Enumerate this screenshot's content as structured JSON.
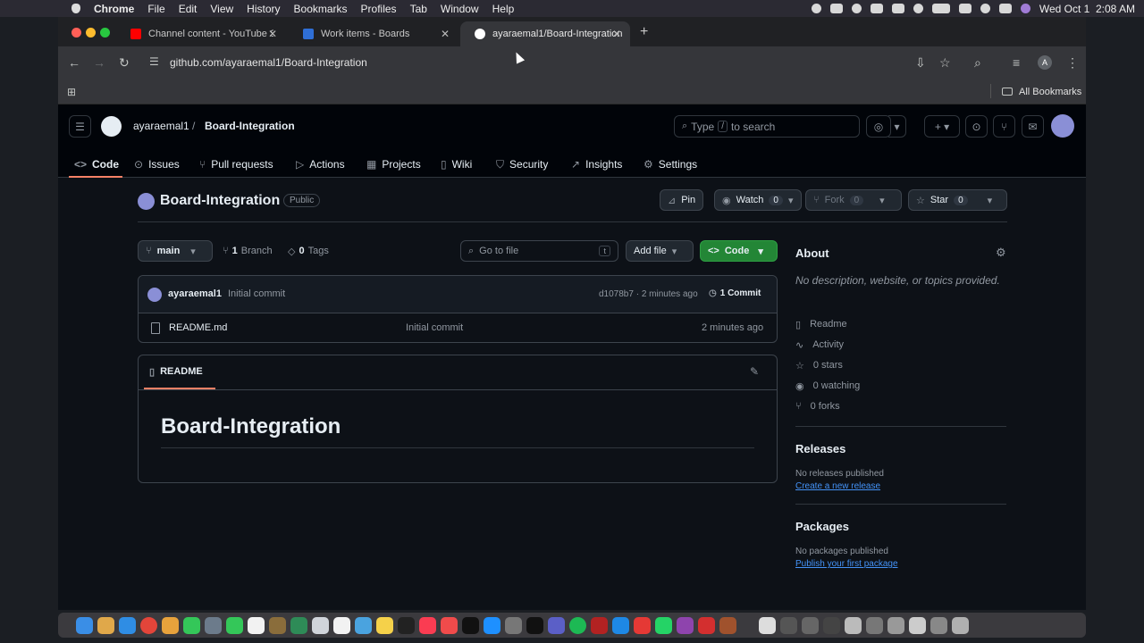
{
  "menubar": {
    "apple": "",
    "app": "Chrome",
    "items": [
      "File",
      "Edit",
      "View",
      "History",
      "Bookmarks",
      "Profiles",
      "Tab",
      "Window",
      "Help"
    ],
    "clock": "Wed Oct 1  2:08 AM"
  },
  "tabs": [
    {
      "title": "Channel content - YouTube St",
      "color": "#ff0000"
    },
    {
      "title": "Work items - Boards",
      "color": "#2f6fd6"
    },
    {
      "title": "ayaraemal1/Board-Integration",
      "color": "#ffffff"
    }
  ],
  "toolbar": {
    "url": "github.com/ayaraemal1/Board-Integration"
  },
  "bookmarks": {
    "all": "All Bookmarks"
  },
  "header": {
    "owner": "ayaraemal1",
    "sep": "/",
    "repo": "Board-Integration",
    "search_placeholder": "Type / to search",
    "search_prefix": "Type",
    "search_key": "/",
    "search_suffix": "to search"
  },
  "nav": [
    {
      "label": "Code",
      "icon": "code-icon"
    },
    {
      "label": "Issues",
      "icon": "issue-icon"
    },
    {
      "label": "Pull requests",
      "icon": "pull-request-icon"
    },
    {
      "label": "Actions",
      "icon": "play-icon"
    },
    {
      "label": "Projects",
      "icon": "table-icon"
    },
    {
      "label": "Wiki",
      "icon": "book-icon"
    },
    {
      "label": "Security",
      "icon": "shield-icon"
    },
    {
      "label": "Insights",
      "icon": "graph-icon"
    },
    {
      "label": "Settings",
      "icon": "gear-icon"
    }
  ],
  "repo": {
    "name": "Board-Integration",
    "visibility": "Public",
    "pin": "Pin",
    "watch": "Watch",
    "watch_count": "0",
    "fork": "Fork",
    "fork_count": "0",
    "star": "Star",
    "star_count": "0"
  },
  "files": {
    "branch": "main",
    "branches_count": "1",
    "branches_label": "Branch",
    "tags_count": "0",
    "tags_label": "Tags",
    "goto_placeholder": "Go to file",
    "goto_key": "t",
    "add_file": "Add file",
    "code": "Code",
    "commit_author": "ayaraemal1",
    "commit_message": "Initial commit",
    "commit_hash": "d1078b7 · 2 minutes ago",
    "commits": "1 Commit",
    "rows": [
      {
        "name": "README.md",
        "message": "Initial commit",
        "age": "2 minutes ago"
      }
    ]
  },
  "readme": {
    "tab": "README",
    "heading": "Board-Integration"
  },
  "about": {
    "title": "About",
    "description": "No description, website, or topics provided.",
    "items": [
      {
        "icon": "book-icon",
        "label": "Readme"
      },
      {
        "icon": "pulse-icon",
        "label": "Activity"
      },
      {
        "icon": "star-icon",
        "label": "0 stars"
      },
      {
        "icon": "eye-icon",
        "label": "0 watching"
      },
      {
        "icon": "fork-icon",
        "label": "0 forks"
      }
    ],
    "releases_title": "Releases",
    "releases_text": "No releases published",
    "releases_link": "Create a new release",
    "packages_title": "Packages",
    "packages_text": "No packages published",
    "packages_link": "Publish your first package"
  },
  "colors": {
    "primary": "#238636",
    "underline": "#f78166",
    "link": "#4493f8"
  }
}
